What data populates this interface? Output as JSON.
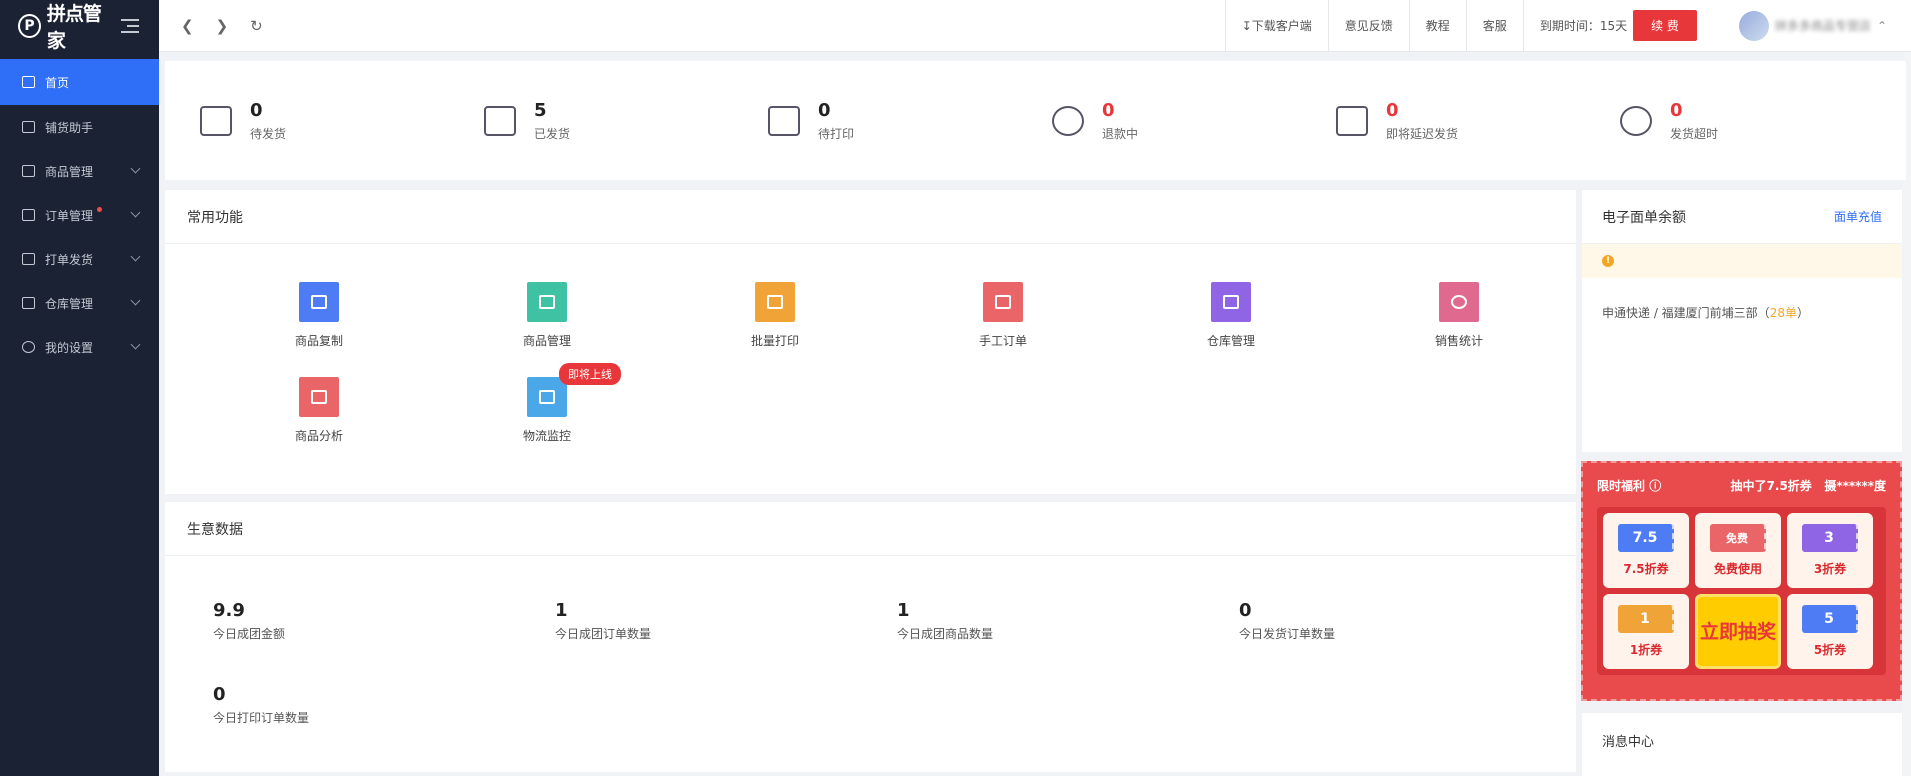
{
  "app": {
    "logo_text": "拼点管家"
  },
  "sidebar": {
    "items": [
      {
        "label": "首页"
      },
      {
        "label": "铺货助手"
      },
      {
        "label": "商品管理"
      },
      {
        "label": "订单管理"
      },
      {
        "label": "打单发货"
      },
      {
        "label": "仓库管理"
      },
      {
        "label": "我的设置"
      }
    ]
  },
  "topbar": {
    "download": "下载客户端",
    "feedback": "意见反馈",
    "tutorial": "教程",
    "service": "客服",
    "expiry": "到期时间：15天",
    "renew": "续 费",
    "user": "拼多多商品专营店"
  },
  "stats": [
    {
      "value": "0",
      "label": "待发货",
      "color": "#222222"
    },
    {
      "value": "5",
      "label": "已发货",
      "color": "#222222"
    },
    {
      "value": "0",
      "label": "待打印",
      "color": "#222222"
    },
    {
      "value": "0",
      "label": "退款中",
      "color": "#e8373a"
    },
    {
      "value": "0",
      "label": "即将延迟发货",
      "color": "#e8373a"
    },
    {
      "value": "0",
      "label": "发货超时",
      "color": "#e8373a"
    }
  ],
  "functions": {
    "title": "常用功能",
    "items": [
      {
        "label": "商品复制",
        "color": "#4d7cf5"
      },
      {
        "label": "商品管理",
        "color": "#3fc1a4"
      },
      {
        "label": "批量打印",
        "color": "#f0a336"
      },
      {
        "label": "手工订单",
        "color": "#ea6568"
      },
      {
        "label": "仓库管理",
        "color": "#8f65e6"
      },
      {
        "label": "销售统计",
        "color": "#e0698f"
      },
      {
        "label": "商品分析",
        "color": "#ea6568"
      },
      {
        "label": "物流监控",
        "color": "#4ba8e8"
      }
    ],
    "soon_badge": "即将上线"
  },
  "business": {
    "title": "生意数据",
    "items": [
      {
        "value": "9.9",
        "label": "今日成团金额"
      },
      {
        "value": "1",
        "label": "今日成团订单数量"
      },
      {
        "value": "1",
        "label": "今日成团商品数量"
      },
      {
        "value": "0",
        "label": "今日发货订单数量"
      },
      {
        "value": "0",
        "label": "今日打印订单数量"
      }
    ]
  },
  "balance": {
    "title": "电子面单余额",
    "recharge": "面单充值",
    "line_prefix": "申通快递 / 福建厦门前埔三部（",
    "line_count": "28单",
    "line_suffix": "）"
  },
  "promo": {
    "title": "限时福利",
    "winner": "抽中了7.5折券",
    "winner_user": "摄******度",
    "cards": [
      {
        "ticket": "7.5",
        "label": "7.5折券",
        "color": "#4d7cf5"
      },
      {
        "ticket": "免费",
        "label": "免费使用",
        "color": "#ea6568"
      },
      {
        "ticket": "3",
        "label": "3折券",
        "color": "#8f65e6"
      },
      {
        "ticket": "1",
        "label": "1折券",
        "color": "#f0a336"
      },
      {
        "ticket": "5",
        "label": "5折券",
        "color": "#4d7cf5"
      }
    ],
    "draw": "立即抽奖"
  },
  "messages": {
    "title": "消息中心"
  }
}
